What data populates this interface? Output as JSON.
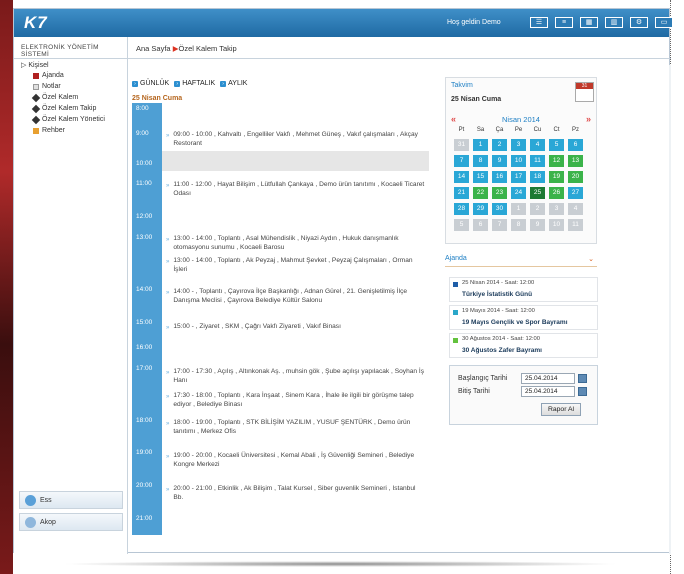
{
  "header": {
    "logo": "K7",
    "welcome": "Hoş geldin Demo",
    "icons": [
      "menu-icon",
      "list-icon",
      "grid-icon",
      "columns-icon",
      "settings-icon",
      "window-icon"
    ]
  },
  "sidebar": {
    "title": "ELEKTRONİK YÖNETİM SİSTEMİ",
    "root": "Kişisel",
    "items": [
      {
        "label": "Ajanda",
        "icon": "book-icon"
      },
      {
        "label": "Notlar",
        "icon": "note-icon"
      },
      {
        "label": "Özel Kalem",
        "icon": "pen-icon"
      },
      {
        "label": "Özel Kalem Takip",
        "icon": "pen-icon"
      },
      {
        "label": "Özel Kalem Yönetici",
        "icon": "pen-icon"
      },
      {
        "label": "Rehber",
        "icon": "contacts-icon"
      }
    ],
    "bottom": [
      {
        "label": "Ess",
        "icon": "ess-icon"
      },
      {
        "label": "Akop",
        "icon": "akop-icon"
      }
    ]
  },
  "breadcrumb": {
    "home": "Ana Sayfa",
    "separator": "▶",
    "current": "Özel Kalem Takip"
  },
  "view_tabs": [
    "GÜNLÜK",
    "HAFTALIK",
    "AYLIK"
  ],
  "day_header": "25 Nisan Cuma",
  "hours": [
    "8:00",
    "9:00",
    "10:00",
    "11:00",
    "12:00",
    "13:00",
    "14:00",
    "15:00",
    "16:00",
    "17:00",
    "18:00",
    "19:00",
    "20:00",
    "21:00"
  ],
  "events": [
    "09:00 - 10:00 , Kahvaltı , Engelliler Vakfı , Mehmet Güneş , Vakıf çalışmaları , Akçay Restorant",
    "11:00 - 12:00 , Hayat Bilişim , Lütfullah Çankaya , Demo ürün tanıtımı , Kocaeli Ticaret Odası",
    "13:00 - 14:00 , Toplantı , Asal Mühendislik , Niyazi Aydın , Hukuk danışmanlık otomasyonu sunumu , Kocaeli Barosu",
    "13:00 - 14:00 , Toplantı , Ak Peyzaj , Mahmut Şevket , Peyzaj Çalışmaları , Orman İşleri",
    "14:00 - , Toplantı , Çayırova İlçe Başkanlığı , Adnan Gürel , 21. Genişletilmiş İlçe Danışma Meclisi , Çayırova Belediye Kültür Salonu",
    "15:00 - , Ziyaret , SKM , Çağrı Vakfı Ziyareti , Vakıf Binası",
    "17:00 - 17:30 , Açılış , Altınkonak Aş. , muhsin gök , Şube açılışı yapılacak , Soyhan İş Hanı",
    "17:30 - 18:00 , Toplantı , Kara İnşaat , Sinem Kara , İhale ile ilgili bir görüşme talep ediyor , Belediye Binası",
    "18:00 - 19:00 , Toplantı , STK BİLİŞİM YAZILIM , YUSUF ŞENTÜRK , Demo ürün tanıtımı , Merkez Ofis",
    "19:00 - 20:00 , Kocaeli Üniversitesi , Kemal Abali , İş Güvenliği Semineri , Belediye Kongre Merkezi",
    "20:00 - 21:00 , Etkinlik , Ak Bilişim , Talat Kursel , Siber guvenlik Semineri , Istanbul Bb."
  ],
  "calendar": {
    "title": "Takvim",
    "date_label": "25 Nisan Cuma",
    "icon_label": "31",
    "month": "Nisan 2014",
    "prev": "«",
    "next": "»",
    "weekdays": [
      "Pt",
      "Sa",
      "Ça",
      "Pe",
      "Cu",
      "Ct",
      "Pz"
    ],
    "rows": [
      [
        "31",
        "1",
        "2",
        "3",
        "4",
        "5",
        "6"
      ],
      [
        "7",
        "8",
        "9",
        "10",
        "11",
        "12",
        "13"
      ],
      [
        "14",
        "15",
        "16",
        "17",
        "18",
        "19",
        "20"
      ],
      [
        "21",
        "22",
        "23",
        "24",
        "25",
        "26",
        "27"
      ],
      [
        "28",
        "29",
        "30",
        "1",
        "2",
        "3",
        "4"
      ],
      [
        "5",
        "6",
        "7",
        "8",
        "9",
        "10",
        "11"
      ]
    ],
    "colors": {
      "day": "#2aa7d6",
      "event": "#3bb34a",
      "today": "#1d7a33",
      "other": "#c9ced3"
    }
  },
  "agenda": {
    "title": "Ajanda",
    "items": [
      {
        "date": "25 Nisan 2014 - Saat: 12:00",
        "title": "Türkiye İstatistik Günü",
        "color": "#1f5ea8"
      },
      {
        "date": "19 Mayıs 2014 - Saat: 12:00",
        "title": "19 Mayıs Gençlik ve Spor Bayramı",
        "color": "#2aa7c9"
      },
      {
        "date": "30 Ağustos 2014 - Saat: 12:00",
        "title": "30 Ağustos Zafer Bayramı",
        "color": "#63c23d"
      }
    ]
  },
  "report": {
    "start_label": "Başlangıç Tarihi",
    "start_value": "25.04.2014",
    "end_label": "Bitiş Tarihi",
    "end_value": "25.04.2014",
    "button": "Rapor Al"
  }
}
